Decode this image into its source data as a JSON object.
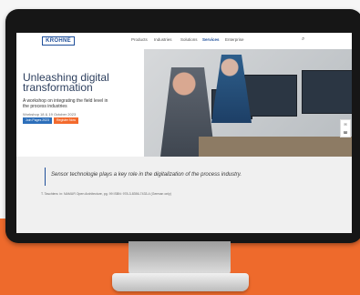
{
  "site": {
    "logo": "KROHNE",
    "menu": [
      "Products",
      "Industries",
      "Solutions",
      "Services",
      "Enterprise"
    ],
    "active_menu": "Services",
    "search_icon": "search-icon"
  },
  "hero": {
    "headline": "Unleashing digital transformation",
    "subheading": "A workshop on integrating the field level in the process industries",
    "event": "Workshop 18 & 19 October 2023",
    "buttons": [
      "Join Pages 2023",
      "Register Now"
    ]
  },
  "quote": {
    "text": "Sensor technologie plays a key role in the digitalization of the process industry.",
    "citation": "T. Taschlers: in: NAMUR Open Architecture, pg. 99 ISBN: 978-3-8356-7433-4 (German only)"
  },
  "sidebar": {
    "icons": [
      "chat-icon",
      "phone-icon"
    ]
  },
  "colors": {
    "accent": "#1f4f9a",
    "orange": "#ee6a2c"
  }
}
